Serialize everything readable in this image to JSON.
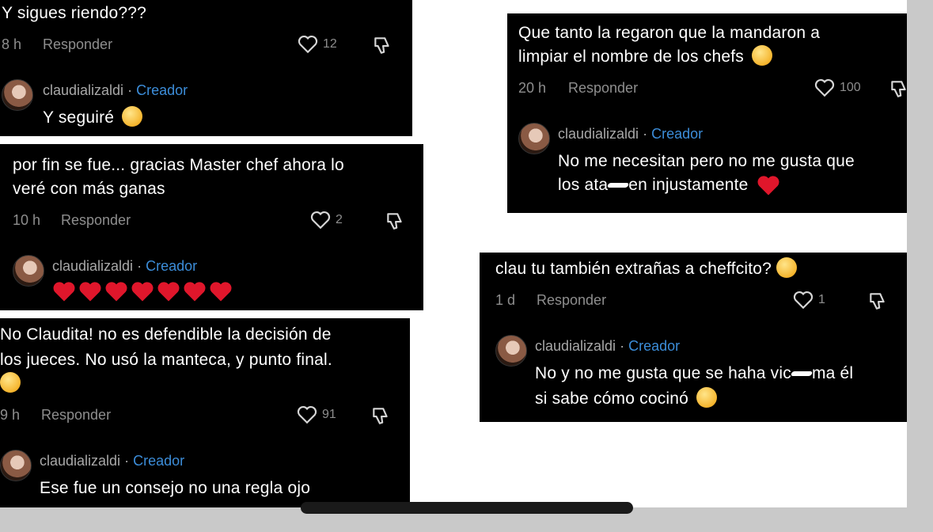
{
  "screenshot": {
    "comments": [
      {
        "text_lines": [
          "Y sigues riendo???"
        ],
        "time": "8 h",
        "reply_label": "Responder",
        "likes": "12",
        "reply": {
          "user": "claudializaldi",
          "separator": "·",
          "badge": "Creador",
          "text": "Y seguiré"
        }
      },
      {
        "text_lines": [
          "por fin se fue... gracias Master chef ahora lo",
          "veré con más ganas"
        ],
        "time": "10 h",
        "reply_label": "Responder",
        "likes": "2",
        "reply": {
          "user": "claudializaldi",
          "separator": "·",
          "badge": "Creador",
          "text": ""
        }
      },
      {
        "text_lines": [
          "No Claudita! no es defendible la decisión de",
          "los jueces. No usó la manteca, y punto final."
        ],
        "time": "9 h",
        "reply_label": "Responder",
        "likes": "91",
        "reply": {
          "user": "claudializaldi",
          "separator": "·",
          "badge": "Creador",
          "text": "Ese fue un consejo no una regla ojo"
        }
      },
      {
        "text_lines": [
          "Que tanto la regaron que la mandaron a",
          "limpiar el nombre de los chefs"
        ],
        "time": "20 h",
        "reply_label": "Responder",
        "likes": "100",
        "reply": {
          "user": "claudializaldi",
          "separator": "·",
          "badge": "Creador",
          "text_lines": [
            "No me necesitan pero no me gusta que",
            "los ata",
            "en injustamente"
          ]
        }
      },
      {
        "text_lines": [
          "clau tu también extrañas a cheffcito?"
        ],
        "time": "1 d",
        "reply_label": "Responder",
        "likes": "1",
        "reply": {
          "user": "claudializaldi",
          "separator": "·",
          "badge": "Creador",
          "text_lines": [
            "No y no me gusta que se haha vic",
            "ma él",
            "si sabe cómo cocinó"
          ]
        }
      }
    ],
    "colors": {
      "card_bg": "#000000",
      "creator_blue": "#3c8dd9",
      "muted": "#8e8e8e",
      "heart_red": "#e0162b"
    },
    "icons": [
      "heart-outline-icon",
      "dislike-icon",
      "avatar",
      "emoji-icon",
      "red-heart-icon"
    ]
  }
}
